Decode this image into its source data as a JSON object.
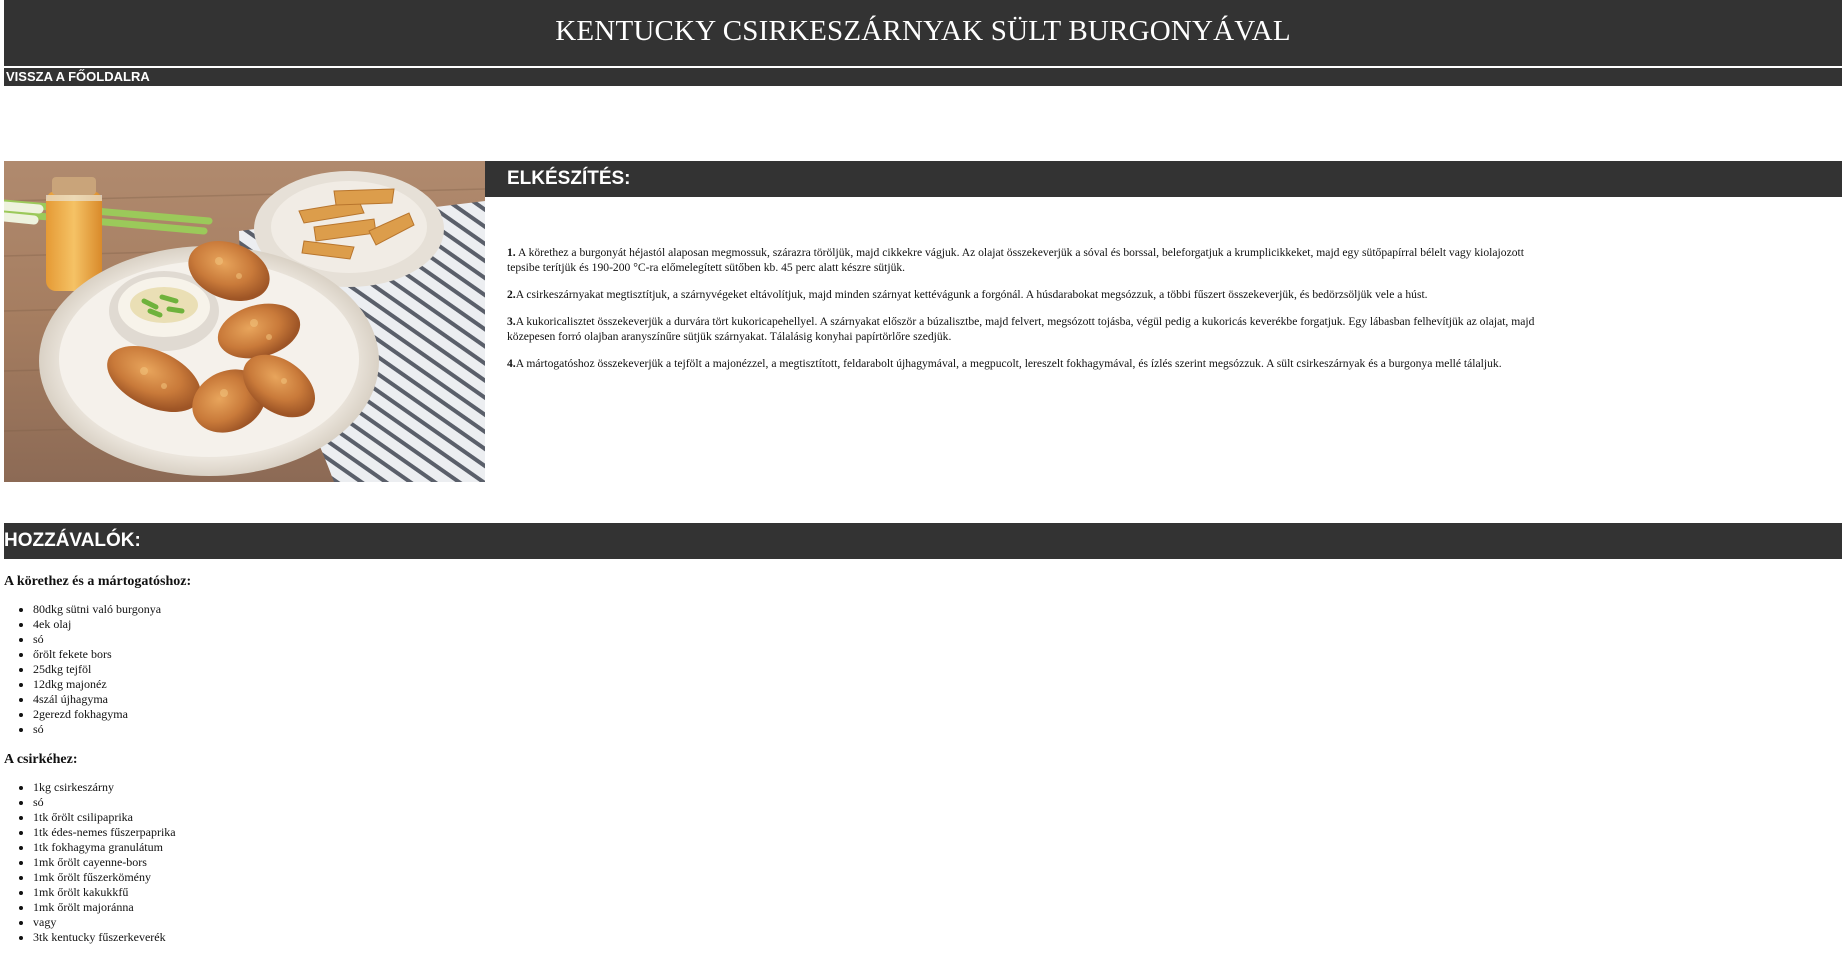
{
  "header": {
    "title": "KENTUCKY CSIRKESZÁRNYAK SÜLT BURGONYÁVAL"
  },
  "nav": {
    "back_label": "VISSZA A FŐOLDALRA"
  },
  "preparation": {
    "heading": "ELKÉSZÍTÉS:",
    "steps": [
      {
        "num": "1.",
        "text": " A körethez a burgonyát héjastól alaposan megmossuk, szárazra töröljük, majd cikkekre vágjuk. Az olajat összekeverjük a sóval és borssal, beleforgatjuk a krumplicikkeket, majd egy sütőpapírral bélelt vagy kiolajozott tepsibe terítjük és 190-200 °C-ra előmelegített sütőben kb. 45 perc alatt készre sütjük."
      },
      {
        "num": "2.",
        "text": "A csirkeszárnyakat megtisztítjuk, a szárnyvégeket eltávolítjuk, majd minden szárnyat kettévágunk a forgónál. A húsdarabokat megsózzuk, a többi fűszert összekeverjük, és bedörzsöljük vele a húst."
      },
      {
        "num": "3.",
        "text": "A kukoricalisztet összekeverjük a durvára tört kukoricapehellyel. A szárnyakat először a búzalisztbe, majd felvert, megsózott tojásba, végül pedig a kukoricás keverékbe forgatjuk. Egy lábasban felhevítjük az olajat, majd közepesen forró olajban aranyszínűre sütjük szárnyakat. Tálalásig konyhai papírtörlőre szedjük."
      },
      {
        "num": "4.",
        "text": "A mártogatóshoz összekeverjük a tejfölt a majonézzel, a megtisztított, feldarabolt újhagymával, a megpucolt, lereszelt fokhagymával, és ízlés szerint megsózzuk. A sült csirkeszárnyak és a burgonya mellé tálaljuk."
      }
    ]
  },
  "ingredients": {
    "heading": "HOZZÁVALÓK:",
    "groups": [
      {
        "title": "A körethez és a mártogatóshoz:",
        "items": [
          "80dkg sütni való burgonya",
          "4ek olaj",
          "só",
          "őrölt fekete bors",
          "25dkg tejföl",
          "12dkg majonéz",
          "4szál újhagyma",
          "2gerezd fokhagyma",
          "só"
        ]
      },
      {
        "title": "A csirkéhez:",
        "items": [
          "1kg csirkeszárny",
          "só",
          "1tk őrölt csilipaprika",
          "1tk édes-nemes fűszerpaprika",
          "1tk fokhagyma granulátum",
          "1mk őrölt cayenne-bors",
          "1mk őrölt fűszerkömény",
          "1mk őrölt kakukkfű",
          "1mk őrölt majoránna",
          "vagy",
          "3tk kentucky fűszerkeverék"
        ]
      }
    ]
  },
  "colors": {
    "bar": "#333333",
    "bar_text": "#ffffff",
    "body_text": "#111111"
  },
  "image": {
    "icon": "recipe-photo"
  }
}
